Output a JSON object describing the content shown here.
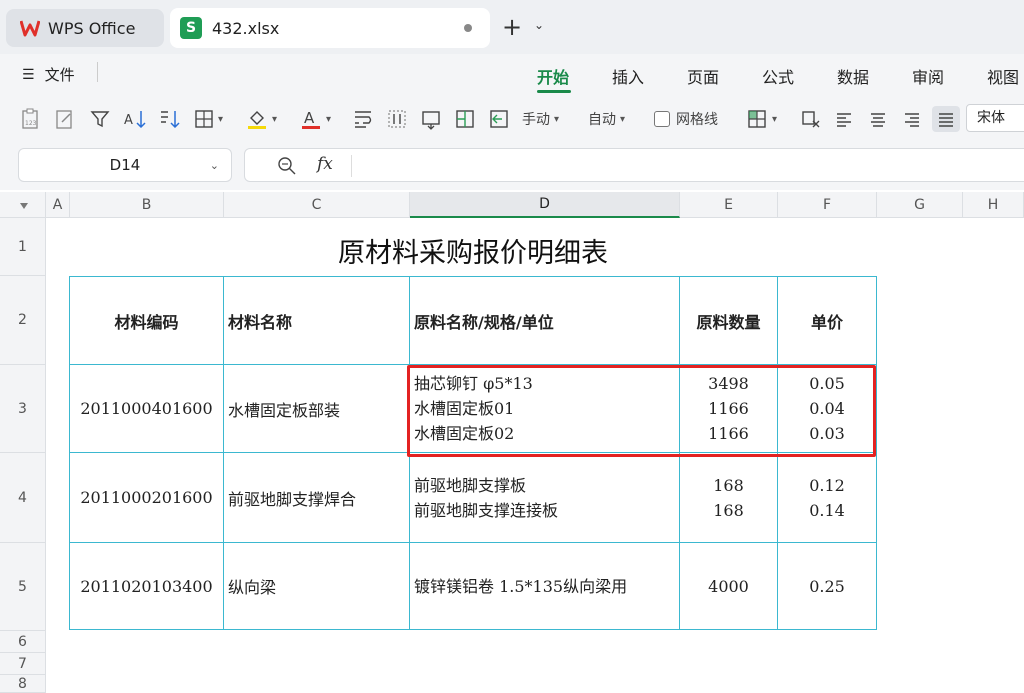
{
  "tabs": {
    "home_label": "WPS Office",
    "file_label": "432.xlsx",
    "file_badge": "S"
  },
  "menu": {
    "file_label": "文件",
    "ribbon_tabs": [
      "开始",
      "插入",
      "页面",
      "公式",
      "数据",
      "审阅",
      "视图"
    ],
    "active_tab": "开始"
  },
  "toolbar": {
    "manual_label": "手动",
    "auto_label": "自动",
    "gridlines_label": "网格线",
    "font_name": "宋体"
  },
  "formula_bar": {
    "cell_ref": "D14",
    "fx_label": "fx",
    "content": ""
  },
  "columns": [
    "A",
    "B",
    "C",
    "D",
    "E",
    "F",
    "G",
    "H"
  ],
  "selected_column": "D",
  "rows": [
    "1",
    "2",
    "3",
    "4",
    "5",
    "6",
    "7",
    "8"
  ],
  "sheet": {
    "title": "原材料采购报价明细表",
    "headers": [
      "材料编码",
      "材料名称",
      "原料名称/规格/单位",
      "原料数量",
      "单价"
    ],
    "records": [
      {
        "code": "2011000401600",
        "name": "水槽固定板部装",
        "materials": [
          "抽芯铆钉  φ5*13",
          "水槽固定板01",
          "水槽固定板02"
        ],
        "quantities": [
          "3498",
          "1166",
          "1166"
        ],
        "prices": [
          "0.05",
          "0.04",
          "0.03"
        ]
      },
      {
        "code": "2011000201600",
        "name": "前驱地脚支撑焊合",
        "materials": [
          "前驱地脚支撑板",
          "前驱地脚支撑连接板"
        ],
        "quantities": [
          "168",
          "168"
        ],
        "prices": [
          "0.12",
          "0.14"
        ]
      },
      {
        "code": "2011020103400",
        "name": "纵向梁",
        "materials": [
          "镀锌镁铝卷 1.5*135纵向梁用"
        ],
        "quantities": [
          "4000"
        ],
        "prices": [
          "0.25"
        ]
      }
    ]
  },
  "colors": {
    "accent": "#1a8a4a",
    "table_border": "#3bb8d0",
    "highlight": "#e32222"
  }
}
